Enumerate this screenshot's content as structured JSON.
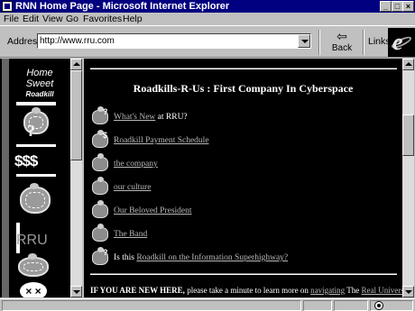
{
  "window": {
    "title": "RNN Home Page - Microsoft Internet Explorer",
    "controls": {
      "minimize": "_",
      "maximize": "□",
      "close": "×"
    }
  },
  "menu": [
    "File",
    "Edit",
    "View",
    "Go",
    "Favorites",
    "Help"
  ],
  "toolbar": {
    "address_label": "Address",
    "address_value": "http://www.rru.com",
    "back_label": "Back",
    "back_icon": "⇦",
    "links_label": "Links",
    "logo_icon": "ie-logo",
    "logo_glyph": "e"
  },
  "left_frame": {
    "home_line1": "Home",
    "home_line2": "Sweet",
    "home_line3": "Roadkill",
    "question_glyph": "?",
    "dollar_glyph": "$$$",
    "rru_glyph": "RRU",
    "bottom_glyph": "× ×"
  },
  "main": {
    "heading": "Roadkills-R-Us : First Company In Cyberspace",
    "nav": [
      {
        "prefix": "",
        "link": "What's New",
        "suffix": " at RRU?",
        "icon": "turtle-question-icon",
        "glyph": "?"
      },
      {
        "prefix": "",
        "link": "Roadkill Payment Schedule",
        "suffix": "",
        "icon": "turtle-money-icon",
        "glyph": "$"
      },
      {
        "prefix": "",
        "link": "the company",
        "suffix": "",
        "icon": "turtle-company-icon",
        "glyph": ""
      },
      {
        "prefix": "",
        "link": "our culture",
        "suffix": "",
        "icon": "turtle-culture-icon",
        "glyph": ""
      },
      {
        "prefix": "",
        "link": "Our Beloved President",
        "suffix": "",
        "icon": "turtle-president-icon",
        "glyph": ""
      },
      {
        "prefix": "",
        "link": "The Band",
        "suffix": "",
        "icon": "turtle-band-icon",
        "glyph": ""
      },
      {
        "prefix": "Is this ",
        "link": "Roadkill on the Information Superhighway?",
        "suffix": "",
        "icon": "turtle-highway-icon",
        "glyph": "?"
      }
    ],
    "footer": {
      "bold": "IF YOU ARE NEW HERE,",
      "text": " please take a minute to learn more on ",
      "link1": "navigating",
      "text2": " The ",
      "link2": "Real Universe"
    }
  }
}
